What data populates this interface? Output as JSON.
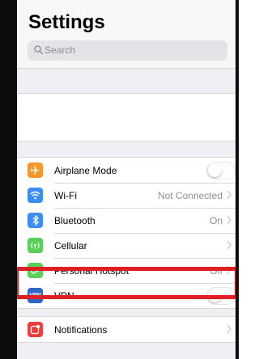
{
  "header": {
    "title": "Settings",
    "search_placeholder": "Search"
  },
  "group_connectivity": [
    {
      "label": "Airplane Mode",
      "icon": "airplane-icon",
      "color": "#f4982b",
      "accessory": "toggle",
      "toggle_on": false
    },
    {
      "label": "Wi-Fi",
      "icon": "wifi-icon",
      "color": "#3d8ef4",
      "value": "Not Connected",
      "accessory": "chevron"
    },
    {
      "label": "Bluetooth",
      "icon": "bluetooth-icon",
      "color": "#3d8ef4",
      "value": "On",
      "accessory": "chevron"
    },
    {
      "label": "Cellular",
      "icon": "cellular-icon",
      "color": "#5ad05a",
      "accessory": "chevron"
    },
    {
      "label": "Personal Hotspot",
      "icon": "hotspot-icon",
      "color": "#5ad05a",
      "value": "Off",
      "accessory": "chevron"
    },
    {
      "label": "VPN",
      "icon": "vpn-icon",
      "icon_text": "VPN",
      "color": "#2e66c8",
      "accessory": "toggle",
      "toggle_on": false
    }
  ],
  "group_notifications": [
    {
      "label": "Notifications",
      "icon": "notifications-icon",
      "color": "#f03c3c",
      "accessory": "chevron"
    }
  ],
  "highlight_color": "#e01f24"
}
